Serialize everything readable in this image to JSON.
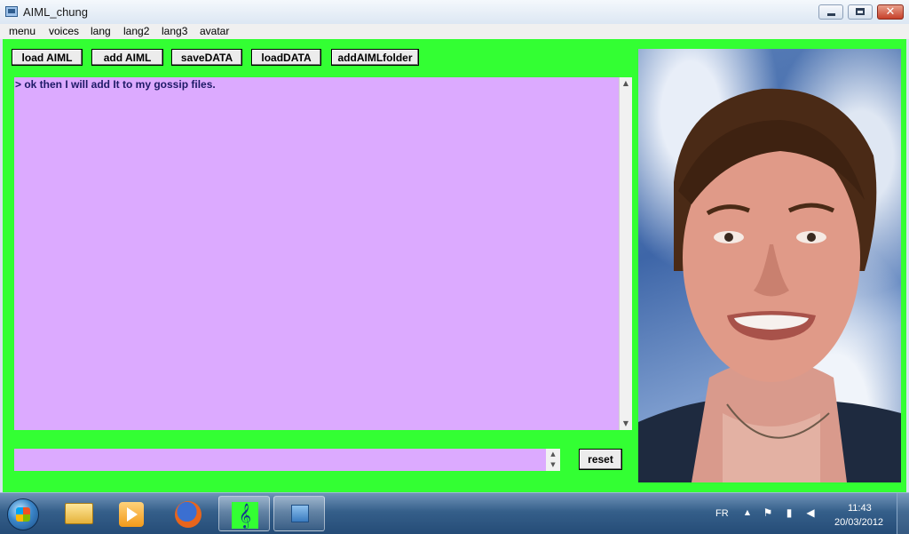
{
  "window": {
    "title": "AIML_chung",
    "close_glyph": "✕"
  },
  "menu": [
    "menu",
    "voices",
    "lang",
    "lang2",
    "lang3",
    "avatar"
  ],
  "toolbar": {
    "load_aiml": "load AIML",
    "add_aiml": "add AIML",
    "save_data": "saveDATA",
    "load_data": "loadDATA",
    "add_aiml_folder": "addAIMLfolder"
  },
  "chat": {
    "line": "> ok then I will add It to my gossip files."
  },
  "input": {
    "value": ""
  },
  "reset_label": "reset",
  "avatar": {
    "description_icon": "talking-head-avatar"
  },
  "taskbar": {
    "apps": [
      "start-orb",
      "explorer-icon",
      "media-player-icon",
      "firefox-icon",
      "music-app-icon",
      "aiml-app-icon"
    ],
    "music_glyph": "𝄞",
    "language": "FR",
    "tray_glyphs": {
      "up": "▲",
      "flag": "⚑",
      "network": "▮",
      "speaker": "◀"
    },
    "time": "11:43",
    "date": "20/03/2012"
  },
  "colors": {
    "client_bg": "#33ff33",
    "chat_bg": "#dcaaff",
    "chat_text": "#1e1a66"
  }
}
